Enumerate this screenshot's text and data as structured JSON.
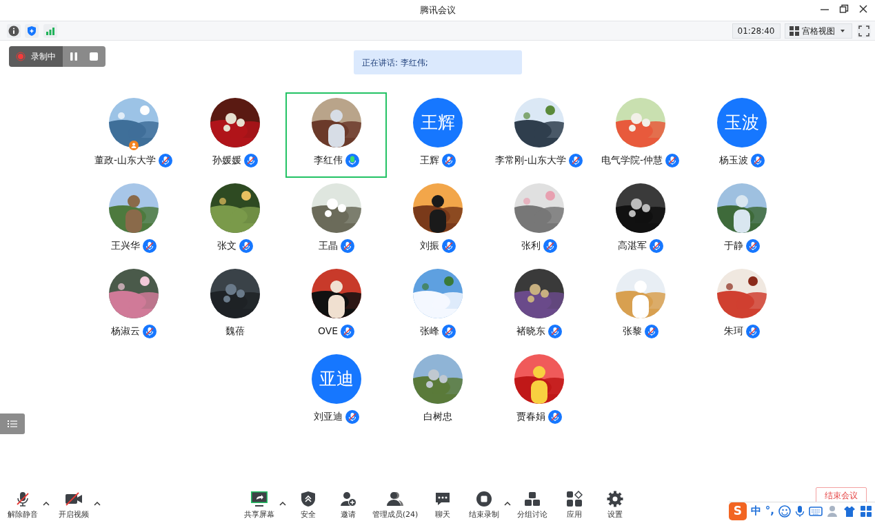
{
  "window": {
    "title": "腾讯会议"
  },
  "info_bar": {
    "timer": "01:28:40",
    "view": "宫格视图"
  },
  "recording": {
    "label": "录制中"
  },
  "speaker_banner": "正在讲话: 李红伟;",
  "participants": [
    {
      "name": "董政-山东大学",
      "mic_muted": true,
      "host": true,
      "speaking": false
    },
    {
      "name": "孙媛媛",
      "mic_muted": true,
      "host": false,
      "speaking": false
    },
    {
      "name": "李红伟",
      "mic_muted": false,
      "host": false,
      "speaking": true
    },
    {
      "name": "王辉",
      "avatar": {
        "kind": "initials",
        "text": "王辉"
      },
      "mic_muted": true,
      "host": false,
      "speaking": false
    },
    {
      "name": "李常刚-山东大学",
      "mic_muted": true,
      "host": false,
      "speaking": false
    },
    {
      "name": "电气学院-仲慧",
      "mic_muted": true,
      "host": false,
      "speaking": false
    },
    {
      "name": "杨玉波",
      "avatar": {
        "kind": "initials",
        "text": "玉波"
      },
      "mic_muted": true,
      "host": false,
      "speaking": false
    },
    {
      "name": "王兴华",
      "mic_muted": true,
      "host": false,
      "speaking": false
    },
    {
      "name": "张文",
      "mic_muted": true,
      "host": false,
      "speaking": false
    },
    {
      "name": "王晶",
      "mic_muted": true,
      "host": false,
      "speaking": false
    },
    {
      "name": "刘振",
      "mic_muted": true,
      "host": false,
      "speaking": false
    },
    {
      "name": "张利",
      "mic_muted": true,
      "host": false,
      "speaking": false
    },
    {
      "name": "高湛军",
      "mic_muted": true,
      "host": false,
      "speaking": false
    },
    {
      "name": "于静",
      "mic_muted": true,
      "host": false,
      "speaking": false
    },
    {
      "name": "杨淑云",
      "mic_muted": true,
      "host": false,
      "speaking": false
    },
    {
      "name": "魏蓓",
      "host": false,
      "speaking": false
    },
    {
      "name": "OVE",
      "mic_muted": true,
      "host": false,
      "speaking": false
    },
    {
      "name": "张峰",
      "mic_muted": true,
      "host": false,
      "speaking": false
    },
    {
      "name": "褚晓东",
      "mic_muted": true,
      "host": false,
      "speaking": false
    },
    {
      "name": "张黎",
      "mic_muted": true,
      "host": false,
      "speaking": false
    },
    {
      "name": "朱珂",
      "mic_muted": true,
      "host": false,
      "speaking": false
    },
    {
      "name": "刘亚迪",
      "avatar": {
        "kind": "initials",
        "text": "亚迪"
      },
      "mic_muted": true,
      "host": false,
      "speaking": false
    },
    {
      "name": "白树忠",
      "host": false,
      "speaking": false
    },
    {
      "name": "贾春娟",
      "mic_muted": true,
      "host": false,
      "speaking": false
    }
  ],
  "toolbar_left": [
    {
      "label": "解除静音",
      "kind": "mic-off",
      "caret": true
    },
    {
      "label": "开启视频",
      "kind": "camera-off",
      "caret": true
    }
  ],
  "toolbar": [
    {
      "label": "共享屏幕",
      "kind": "share",
      "caret": true
    },
    {
      "label": "安全",
      "kind": "shield",
      "caret": false
    },
    {
      "label": "邀请",
      "kind": "invite",
      "caret": false
    },
    {
      "label": "管理成员(24)",
      "kind": "members",
      "caret": false
    },
    {
      "label": "聊天",
      "kind": "chat",
      "caret": false
    },
    {
      "label": "结束录制",
      "kind": "stop",
      "caret": true
    },
    {
      "label": "分组讨论",
      "kind": "groups",
      "caret": false
    },
    {
      "label": "应用",
      "kind": "apps",
      "caret": false
    },
    {
      "label": "设置",
      "kind": "settings",
      "caret": false
    }
  ],
  "end_button": "结束会议",
  "ime_bar": {
    "logo": "S",
    "items": [
      "中",
      "°,"
    ]
  }
}
